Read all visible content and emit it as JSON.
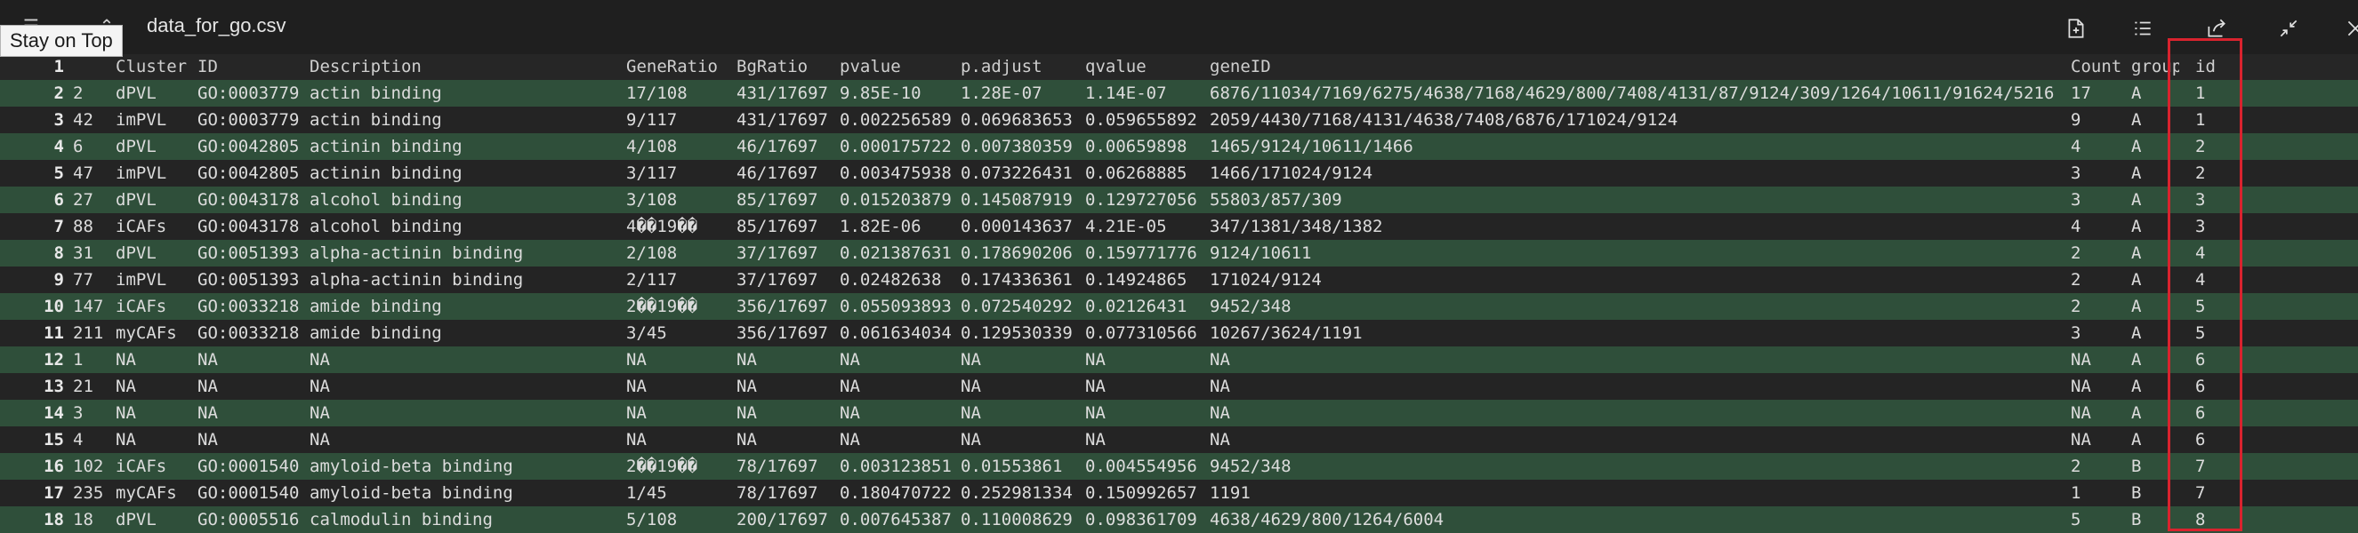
{
  "window": {
    "filename": "data_for_go.csv",
    "tooltip": "Stay on Top"
  },
  "toolbar_icons": [
    "new-file-icon",
    "list-icon",
    "share-icon",
    "collapse-icon",
    "close-icon"
  ],
  "table": {
    "header_num": "1",
    "columns": [
      "",
      "Cluster",
      "ID",
      "Description",
      "GeneRatio",
      "BgRatio",
      "pvalue",
      "p.adjust",
      "qvalue",
      "geneID",
      "Count",
      "group",
      "id"
    ],
    "rows": [
      {
        "num": "2",
        "cells": [
          "2",
          "dPVL",
          "GO:0003779",
          "actin binding",
          "17/108",
          "431/17697",
          "9.85E-10",
          "1.28E-07",
          "1.14E-07",
          "6876/11034/7169/6275/4638/7168/4629/800/7408/4131/87/9124/309/1264/10611/91624/5216",
          "17",
          "A",
          "1"
        ]
      },
      {
        "num": "3",
        "cells": [
          "42",
          "imPVL",
          "GO:0003779",
          "actin binding",
          "9/117",
          "431/17697",
          "0.002256589",
          "0.069683653",
          "0.059655892",
          "2059/4430/7168/4131/4638/7408/6876/171024/9124",
          "9",
          "A",
          "1"
        ]
      },
      {
        "num": "4",
        "cells": [
          "6",
          "dPVL",
          "GO:0042805",
          "actinin binding",
          "4/108",
          "46/17697",
          "0.000175722",
          "0.007380359",
          "0.00659898",
          "1465/9124/10611/1466",
          "4",
          "A",
          "2"
        ]
      },
      {
        "num": "5",
        "cells": [
          "47",
          "imPVL",
          "GO:0042805",
          "actinin binding",
          "3/117",
          "46/17697",
          "0.003475938",
          "0.073226431",
          "0.06268885",
          "1466/171024/9124",
          "3",
          "A",
          "2"
        ]
      },
      {
        "num": "6",
        "cells": [
          "27",
          "dPVL",
          "GO:0043178",
          "alcohol binding",
          "3/108",
          "85/17697",
          "0.015203879",
          "0.145087919",
          "0.129727056",
          "55803/857/309",
          "3",
          "A",
          "3"
        ]
      },
      {
        "num": "7",
        "cells": [
          "88",
          "iCAFs",
          "GO:0043178",
          "alcohol binding",
          "4��19��",
          "85/17697",
          "1.82E-06",
          "0.000143637",
          "4.21E-05",
          "347/1381/348/1382",
          "4",
          "A",
          "3"
        ]
      },
      {
        "num": "8",
        "cells": [
          "31",
          "dPVL",
          "GO:0051393",
          "alpha-actinin binding",
          "2/108",
          "37/17697",
          "0.021387631",
          "0.178690206",
          "0.159771776",
          "9124/10611",
          "2",
          "A",
          "4"
        ]
      },
      {
        "num": "9",
        "cells": [
          "77",
          "imPVL",
          "GO:0051393",
          "alpha-actinin binding",
          "2/117",
          "37/17697",
          "0.02482638",
          "0.174336361",
          "0.14924865",
          "171024/9124",
          "2",
          "A",
          "4"
        ]
      },
      {
        "num": "10",
        "cells": [
          "147",
          "iCAFs",
          "GO:0033218",
          "amide binding",
          "2��19��",
          "356/17697",
          "0.055093893",
          "0.072540292",
          "0.02126431",
          "9452/348",
          "2",
          "A",
          "5"
        ]
      },
      {
        "num": "11",
        "cells": [
          "211",
          "myCAFs",
          "GO:0033218",
          "amide binding",
          "3/45",
          "356/17697",
          "0.061634034",
          "0.129530339",
          "0.077310566",
          "10267/3624/1191",
          "3",
          "A",
          "5"
        ]
      },
      {
        "num": "12",
        "cells": [
          "1",
          "NA",
          "NA",
          "NA",
          "NA",
          "NA",
          "NA",
          "NA",
          "NA",
          "NA",
          "NA",
          "A",
          "6"
        ]
      },
      {
        "num": "13",
        "cells": [
          "21",
          "NA",
          "NA",
          "NA",
          "NA",
          "NA",
          "NA",
          "NA",
          "NA",
          "NA",
          "NA",
          "A",
          "6"
        ]
      },
      {
        "num": "14",
        "cells": [
          "3",
          "NA",
          "NA",
          "NA",
          "NA",
          "NA",
          "NA",
          "NA",
          "NA",
          "NA",
          "NA",
          "A",
          "6"
        ]
      },
      {
        "num": "15",
        "cells": [
          "4",
          "NA",
          "NA",
          "NA",
          "NA",
          "NA",
          "NA",
          "NA",
          "NA",
          "NA",
          "NA",
          "A",
          "6"
        ]
      },
      {
        "num": "16",
        "cells": [
          "102",
          "iCAFs",
          "GO:0001540",
          "amyloid-beta binding",
          "2��19��",
          "78/17697",
          "0.003123851",
          "0.01553861",
          "0.004554956",
          "9452/348",
          "2",
          "B",
          "7"
        ]
      },
      {
        "num": "17",
        "cells": [
          "235",
          "myCAFs",
          "GO:0001540",
          "amyloid-beta binding",
          "1/45",
          "78/17697",
          "0.180470722",
          "0.252981334",
          "0.150992657",
          "1191",
          "1",
          "B",
          "7"
        ]
      },
      {
        "num": "18",
        "cells": [
          "18",
          "dPVL",
          "GO:0005516",
          "calmodulin binding",
          "5/108",
          "200/17697",
          "0.007645387",
          "0.110008629",
          "0.098361709",
          "4638/4629/800/1264/6004",
          "5",
          "B",
          "8"
        ]
      }
    ]
  },
  "colors": {
    "background": "#1f1f1f",
    "row_highlight": "#2f4f3a",
    "annotation_box": "#d9232e"
  }
}
